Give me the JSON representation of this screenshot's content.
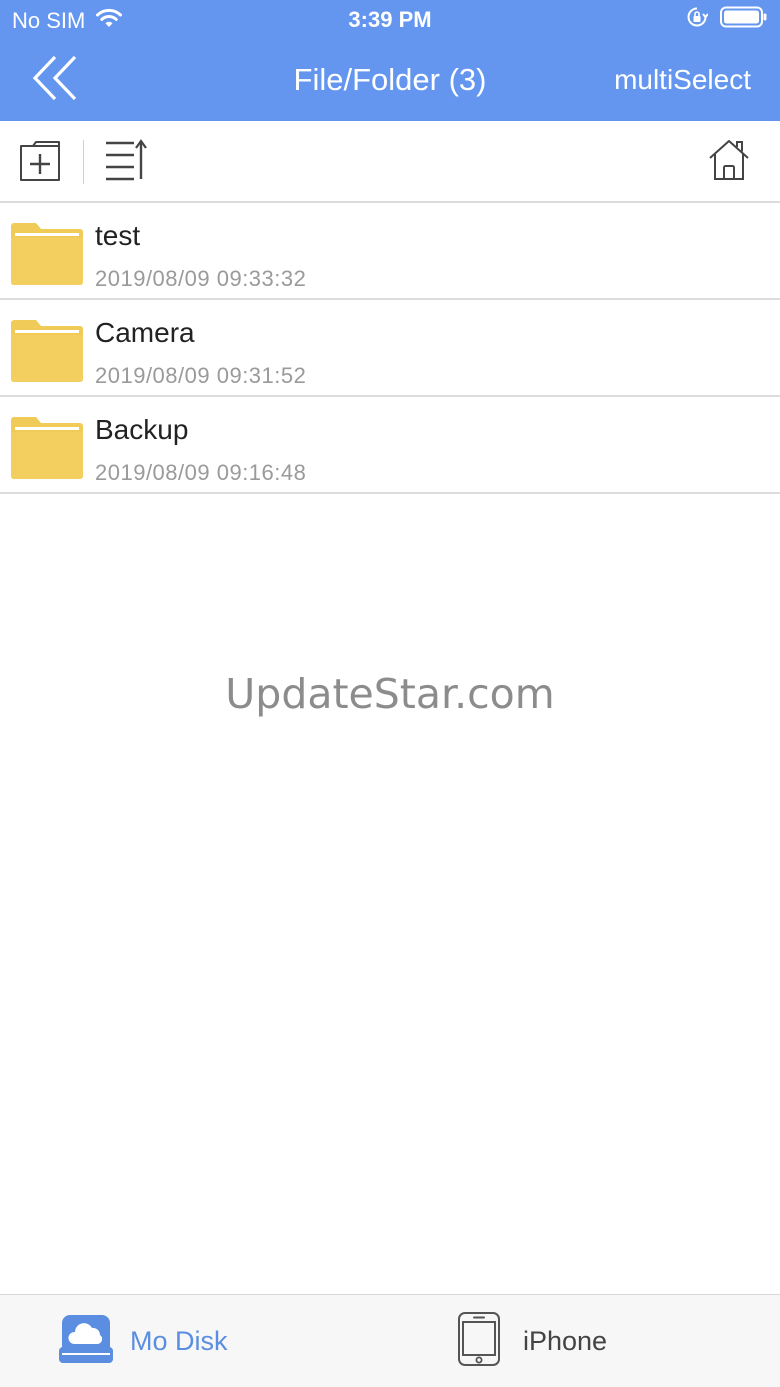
{
  "status_bar": {
    "carrier": "No SIM",
    "time": "3:39 PM",
    "icons": [
      "wifi-icon",
      "orientation-lock-icon",
      "battery-icon"
    ]
  },
  "nav_bar": {
    "back_icon": "double-chevron-left-icon",
    "title": "File/Folder (3)",
    "multiselect_label": "multiSelect"
  },
  "toolbar": {
    "icons": [
      "new-folder-icon",
      "sort-list-icon",
      "home-icon"
    ]
  },
  "files": [
    {
      "name": "test",
      "date": "2019/08/09 09:33:32",
      "icon": "folder-icon"
    },
    {
      "name": "Camera",
      "date": "2019/08/09 09:31:52",
      "icon": "folder-icon"
    },
    {
      "name": "Backup",
      "date": "2019/08/09 09:16:48",
      "icon": "folder-icon"
    }
  ],
  "watermark": "UpdateStar.com",
  "tab_bar": {
    "tabs": [
      {
        "label": "Mo Disk",
        "icon": "cloud-disk-icon",
        "active": true
      },
      {
        "label": "iPhone",
        "icon": "iphone-icon",
        "active": false
      }
    ]
  },
  "colors": {
    "header": "#6496ef",
    "folder": "#f0cb58",
    "active_tab": "#5b8de0",
    "divider": "#dcdcdc"
  }
}
